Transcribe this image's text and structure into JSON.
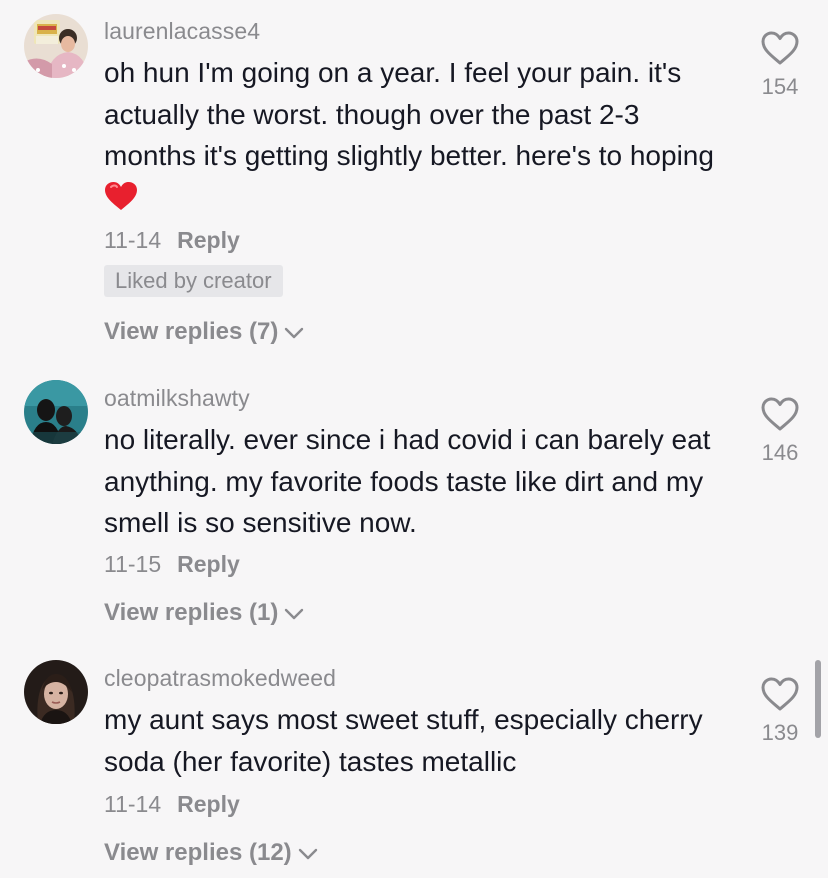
{
  "comments": [
    {
      "username": "laurenlacasse4",
      "text": "oh hun I'm going on a year. I feel your pain. it's actually the worst. though over the past 2-3 months it's getting slightly better. here's to hoping",
      "date": "11-14",
      "reply_label": "Reply",
      "liked_badge": "Liked by creator",
      "view_replies": "View replies (7)",
      "likes": "154",
      "icon": "heart-outline-icon"
    },
    {
      "username": "oatmilkshawty",
      "text": "no literally. ever since i had covid i can barely eat anything. my favorite foods taste like dirt and my smell is so sensitive now.",
      "date": "11-15",
      "reply_label": "Reply",
      "view_replies": "View replies (1)",
      "likes": "146",
      "icon": "heart-outline-icon"
    },
    {
      "username": "cleopatrasmokedweed",
      "text": "my aunt says most sweet stuff, especially cherry soda (her favorite) tastes metallic",
      "date": "11-14",
      "reply_label": "Reply",
      "view_replies": "View replies (12)",
      "likes": "139",
      "icon": "heart-outline-icon"
    }
  ],
  "colors": {
    "background": "#f7f6f7",
    "text": "#161823",
    "secondary": "#8a8a8e",
    "badge_bg": "#e6e6e9",
    "emoji_heart": "#e8202e"
  }
}
